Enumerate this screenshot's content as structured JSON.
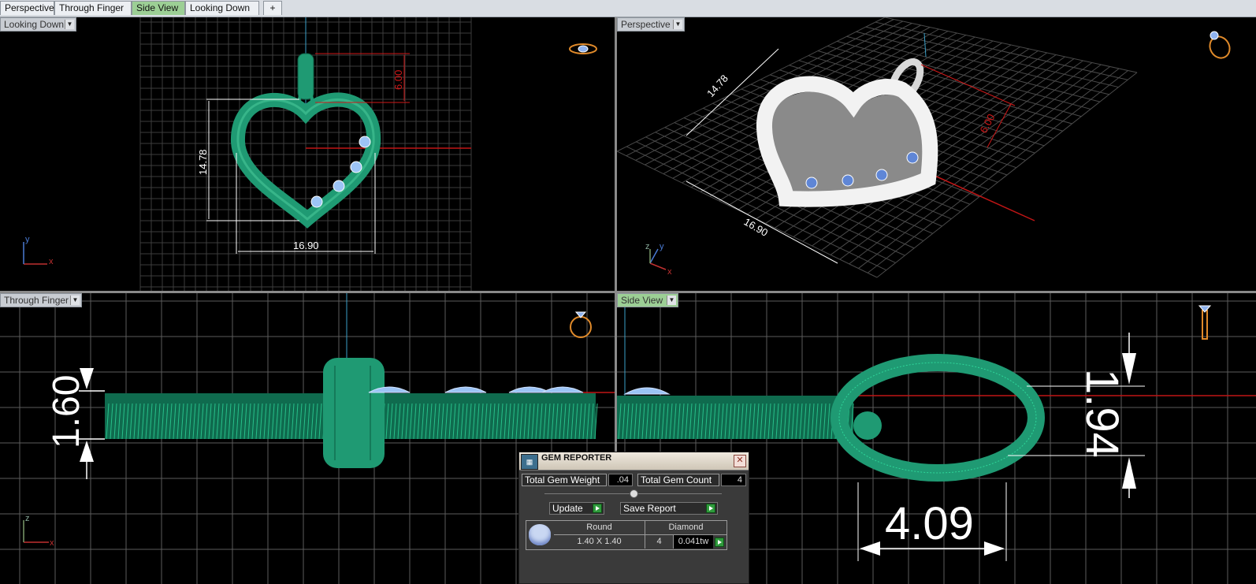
{
  "tabs": [
    "Perspective",
    "Through Finger",
    "Side View",
    "Looking Down"
  ],
  "tab_add": "+",
  "viewports": {
    "top_left": {
      "label": "Looking Down",
      "dims": {
        "width": "16.90",
        "height": "14.78",
        "bail": "6.00"
      },
      "axes": {
        "v": "y",
        "h": "x"
      }
    },
    "top_right": {
      "label": "Perspective",
      "dims": {
        "width": "16.90",
        "height": "14.78",
        "bail": "6.00"
      },
      "axes": {
        "v": "y",
        "h": "x",
        "z": "z"
      }
    },
    "bottom_left": {
      "label": "Through Finger",
      "dims": {
        "thickness": "1.60"
      },
      "axes": {
        "v": "z",
        "h": "x"
      }
    },
    "bottom_right": {
      "label": "Side View",
      "dims": {
        "bail_height": "1.94",
        "bail_width": "4.09"
      }
    }
  },
  "gem_reporter": {
    "title": "GEM REPORTER",
    "total_weight_label": "Total Gem Weight",
    "total_weight_value": ".04",
    "total_count_label": "Total Gem Count",
    "total_count_value": "4",
    "update_label": "Update",
    "save_label": "Save Report",
    "rows": [
      {
        "shape": "Round",
        "size": "1.40 X 1.40",
        "material": "Diamond",
        "count": "4",
        "weight": "0.041tw"
      }
    ]
  },
  "colors": {
    "model_green": "#1f9a73",
    "gem_blue": "#7fa8e8",
    "dim_white": "#ffffff",
    "dim_red": "#d01818",
    "grid": "#6a6a6a",
    "accent_tab": "#9ccf95"
  }
}
